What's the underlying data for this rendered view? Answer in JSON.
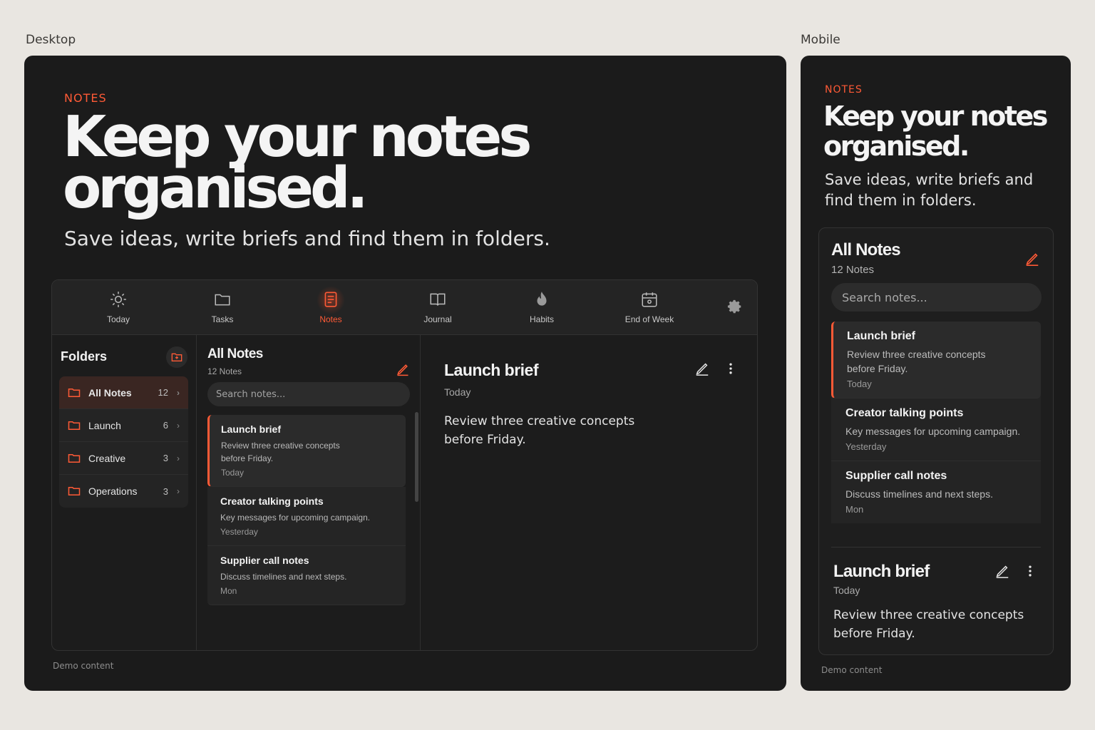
{
  "labels": {
    "desktop": "Desktop",
    "mobile": "Mobile"
  },
  "hero": {
    "eyebrow": "NOTES",
    "headline_line1": "Keep your notes",
    "headline_line2": "organised.",
    "subtitle": "Save ideas, write briefs and find them in folders."
  },
  "nav": [
    {
      "label": "Today",
      "icon": "sun-icon"
    },
    {
      "label": "Tasks",
      "icon": "folder-icon"
    },
    {
      "label": "Notes",
      "icon": "note-icon",
      "active": true
    },
    {
      "label": "Journal",
      "icon": "book-icon"
    },
    {
      "label": "Habits",
      "icon": "flame-icon"
    },
    {
      "label": "End of Week",
      "icon": "calendar-icon"
    }
  ],
  "settings_icon": "gear-icon",
  "folders": {
    "title": "Folders",
    "new_icon": "folder-plus-icon",
    "items": [
      {
        "label": "All Notes",
        "count": "12",
        "active": true
      },
      {
        "label": "Launch",
        "count": "6"
      },
      {
        "label": "Creative",
        "count": "3"
      },
      {
        "label": "Operations",
        "count": "3"
      }
    ]
  },
  "list": {
    "title": "All Notes",
    "count": "12 Notes",
    "search_placeholder": "Search notes...",
    "notes": [
      {
        "title": "Launch brief",
        "body": "Review three creative concepts before Friday.",
        "date": "Today",
        "active": true
      },
      {
        "title": "Creator talking points",
        "body": "Key messages for upcoming campaign.",
        "date": "Yesterday"
      },
      {
        "title": "Supplier call notes",
        "body": "Discuss timelines and next steps.",
        "date": "Mon"
      }
    ]
  },
  "detail": {
    "title": "Launch brief",
    "date": "Today",
    "body": "Review three creative concepts before Friday."
  },
  "footer": {
    "demo": "Demo content"
  },
  "colors": {
    "accent": "#ff5a36",
    "panel": "#1b1b1b",
    "page": "#e9e6e1"
  }
}
